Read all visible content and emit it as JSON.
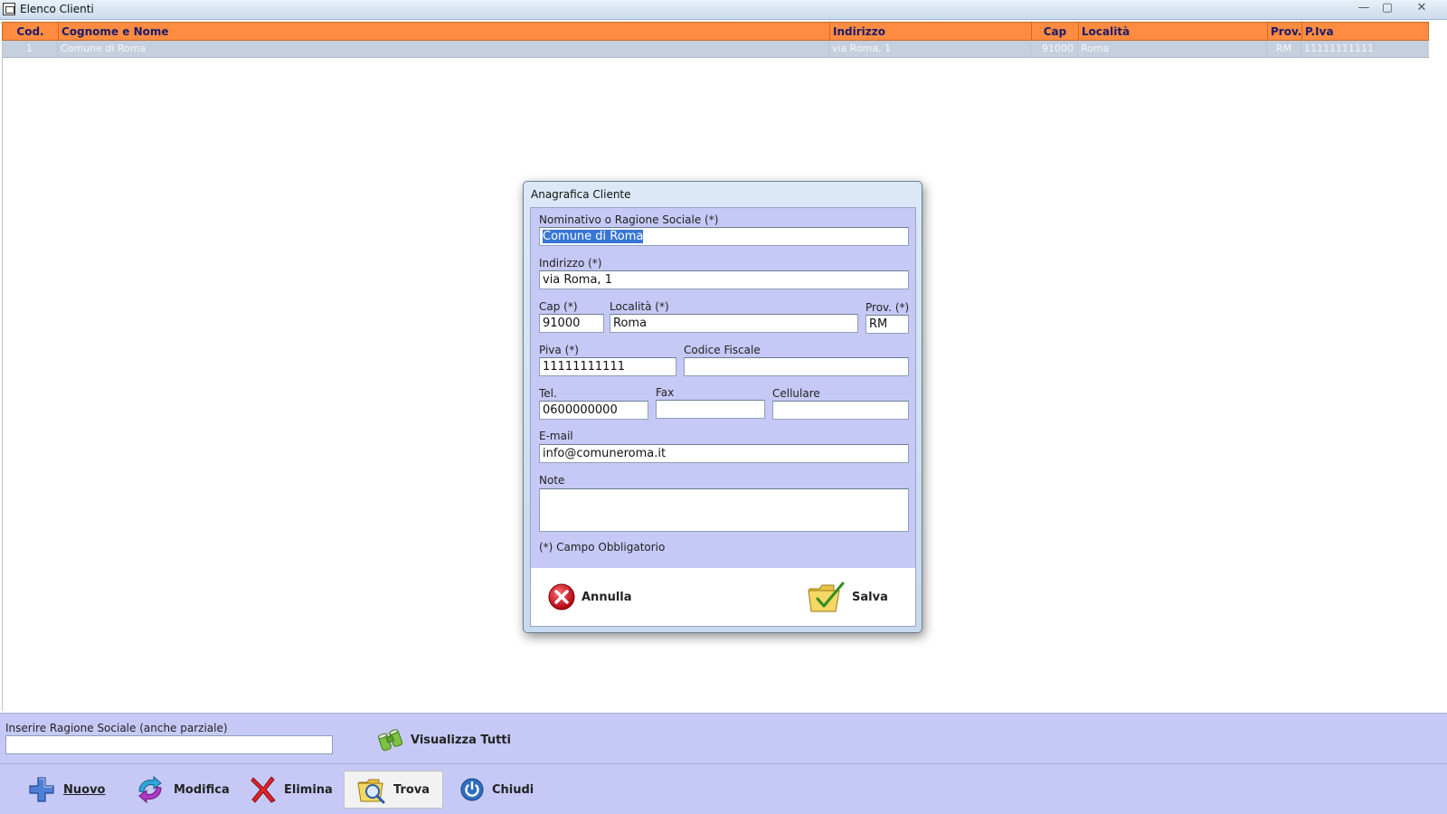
{
  "window": {
    "title": "Elenco Clienti",
    "controls": [
      "—",
      "▢",
      "✕"
    ]
  },
  "grid": {
    "columns": [
      "Cod.",
      "Cognome e Nome",
      "Indirizzo",
      "Cap",
      "Località",
      "Prov.",
      "P.Iva"
    ],
    "rows": [
      {
        "cod": "1",
        "name": "Comune di Roma",
        "indirizzo": "via Roma, 1",
        "cap": "91000",
        "localita": "Roma",
        "prov": "RM",
        "piva": "11111111111"
      }
    ]
  },
  "dialog": {
    "title": "Anagrafica Cliente",
    "fields": {
      "nominativo": {
        "label": "Nominativo o Ragione Sociale (*)",
        "value": "Comune di Roma"
      },
      "indirizzo": {
        "label": "Indirizzo (*)",
        "value": "via Roma, 1"
      },
      "cap": {
        "label": "Cap (*)",
        "value": "91000"
      },
      "localita": {
        "label": "Località (*)",
        "value": "Roma"
      },
      "prov": {
        "label": "Prov. (*)",
        "value": "RM"
      },
      "piva": {
        "label": "Piva (*)",
        "value": "11111111111"
      },
      "codice_fiscale": {
        "label": "Codice Fiscale",
        "value": ""
      },
      "tel": {
        "label": "Tel.",
        "value": "0600000000"
      },
      "fax": {
        "label": "Fax",
        "value": ""
      },
      "cellulare": {
        "label": "Cellulare",
        "value": ""
      },
      "email": {
        "label": "E-mail",
        "value": "info@comuneroma.it"
      },
      "note": {
        "label": "Note",
        "value": ""
      }
    },
    "required_note": "(*) Campo Obbligatorio",
    "cancel_label": "Annulla",
    "save_label": "Salva"
  },
  "search": {
    "label": "Inserire Ragione Sociale (anche parziale)",
    "value": "",
    "show_all_label": "Visualizza Tutti"
  },
  "toolbar": {
    "new_label": "Nuovo",
    "edit_label": "Modifica",
    "delete_label": "Elimina",
    "find_label": "Trova",
    "close_label": "Chiudi"
  },
  "colors": {
    "header_orange": "#ff8c40",
    "panel_lavender": "#c6c9f5",
    "selected_row": "#c5cfdd",
    "selection_blue": "#3876d6"
  }
}
